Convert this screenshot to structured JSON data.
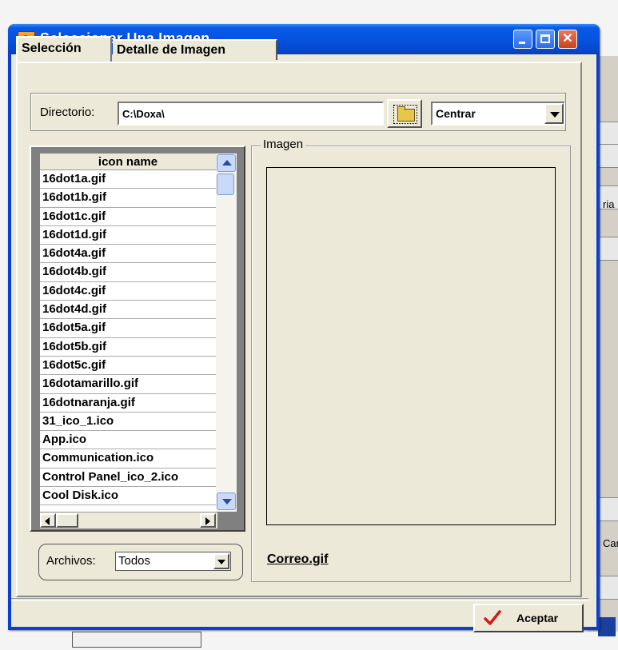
{
  "window": {
    "title": "Seleccionar Una Imagen"
  },
  "tabs": [
    {
      "label": "Selección"
    },
    {
      "label": "Detalle de Imagen"
    }
  ],
  "directory": {
    "label": "Directorio:",
    "value": "C:\\Doxa\\",
    "alignment": "Centrar"
  },
  "list": {
    "header": "icon name",
    "items": [
      "16dot1a.gif",
      "16dot1b.gif",
      "16dot1c.gif",
      "16dot1d.gif",
      "16dot4a.gif",
      "16dot4b.gif",
      "16dot4c.gif",
      "16dot4d.gif",
      "16dot5a.gif",
      "16dot5b.gif",
      "16dot5c.gif",
      "16dotamarillo.gif",
      "16dotnaranja.gif",
      "31_ico_1.ico",
      "App.ico",
      "Communication.ico",
      "Control Panel_ico_2.ico",
      "Cool Disk.ico"
    ]
  },
  "files": {
    "label": "Archivos:",
    "value": "Todos"
  },
  "image": {
    "label": "Imagen",
    "filename": "Correo.gif"
  },
  "accept": {
    "label": "Aceptar"
  },
  "background": {
    "text1": "ria",
    "text2": "Car"
  },
  "colors": {
    "titlebar": "#0554e0",
    "dialog_bg": "#ece9d8",
    "check": "#d21c1c"
  }
}
